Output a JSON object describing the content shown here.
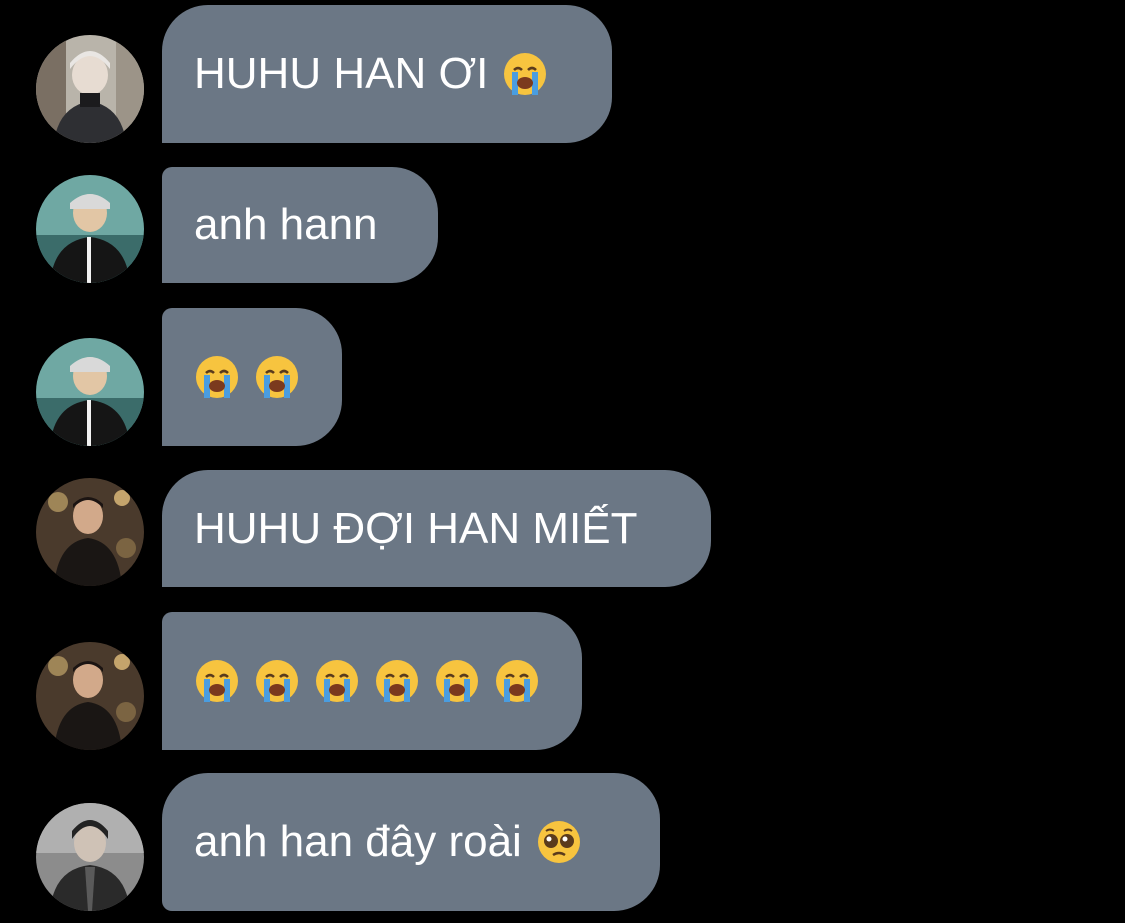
{
  "messages": [
    {
      "text": "HUHU HAN ƠI",
      "emojis": [
        "crying-face"
      ],
      "avatar": "avatar-silver-hair"
    },
    {
      "text": "anh hann",
      "emojis": [],
      "avatar": "avatar-cap-jacket"
    },
    {
      "text": "",
      "emojis": [
        "crying-face",
        "crying-face"
      ],
      "avatar": "avatar-cap-jacket"
    },
    {
      "text": "HUHU ĐỢI HAN MIẾT",
      "emojis": [],
      "avatar": "avatar-dark-suit"
    },
    {
      "text": "",
      "emojis": [
        "crying-face",
        "crying-face",
        "crying-face",
        "crying-face",
        "crying-face",
        "crying-face"
      ],
      "avatar": "avatar-dark-suit"
    },
    {
      "text": "anh han đây roài",
      "emojis": [
        "pleading-face"
      ],
      "avatar": "avatar-tie-portrait"
    }
  ],
  "colors": {
    "background": "#000000",
    "bubble": "#6b7785",
    "text": "#ffffff"
  }
}
